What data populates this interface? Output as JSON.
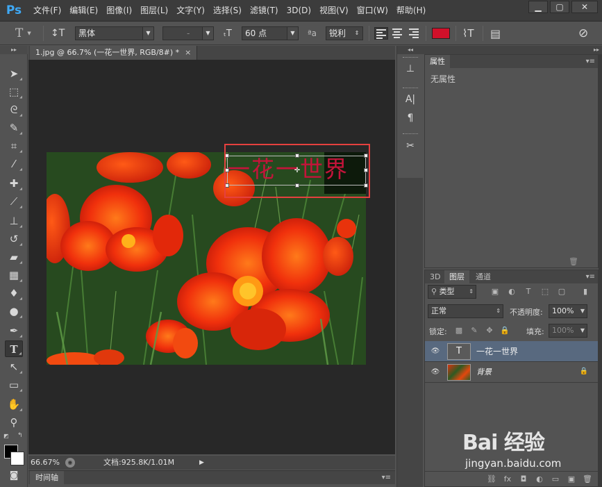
{
  "app": {
    "logo": "Ps",
    "menu": [
      "文件(F)",
      "编辑(E)",
      "图像(I)",
      "图层(L)",
      "文字(Y)",
      "选择(S)",
      "滤镜(T)",
      "3D(D)",
      "视图(V)",
      "窗口(W)",
      "帮助(H)"
    ],
    "window_controls": [
      "minimize-icon",
      "maximize-icon",
      "close-icon"
    ]
  },
  "options_bar": {
    "font_family": "黑体",
    "font_style": "-",
    "font_size": "60 点",
    "aa_label": "ªa",
    "antialias": "锐利",
    "text_color": "#d0102a"
  },
  "document": {
    "tab_title": "1.jpg @ 66.7% (一花一世界, RGB/8#) *",
    "tab_close": "×",
    "text_layer_content": "一花一世界",
    "text_color": "#c4143a",
    "highlight_color": "#e5403f"
  },
  "status": {
    "zoom": "66.67%",
    "doc_size": "文档:925.8K/1.01M"
  },
  "timeline": {
    "tab": "时间轴"
  },
  "properties_panel": {
    "tab": "属性",
    "empty_text": "无属性"
  },
  "layers_panel": {
    "tabs": [
      "3D",
      "图层",
      "通道"
    ],
    "active_tab": "图层",
    "filter_label": "类型",
    "blend_mode": "正常",
    "opacity_label": "不透明度:",
    "opacity_value": "100%",
    "lock_label": "锁定:",
    "fill_label": "填充:",
    "fill_value": "100%",
    "layers": [
      {
        "name": "一花一世界",
        "type": "text",
        "selected": true
      },
      {
        "name": "背景",
        "type": "image",
        "locked": true
      }
    ]
  },
  "watermark": {
    "logo": "Bai 经验",
    "url": "jingyan.baidu.com"
  }
}
